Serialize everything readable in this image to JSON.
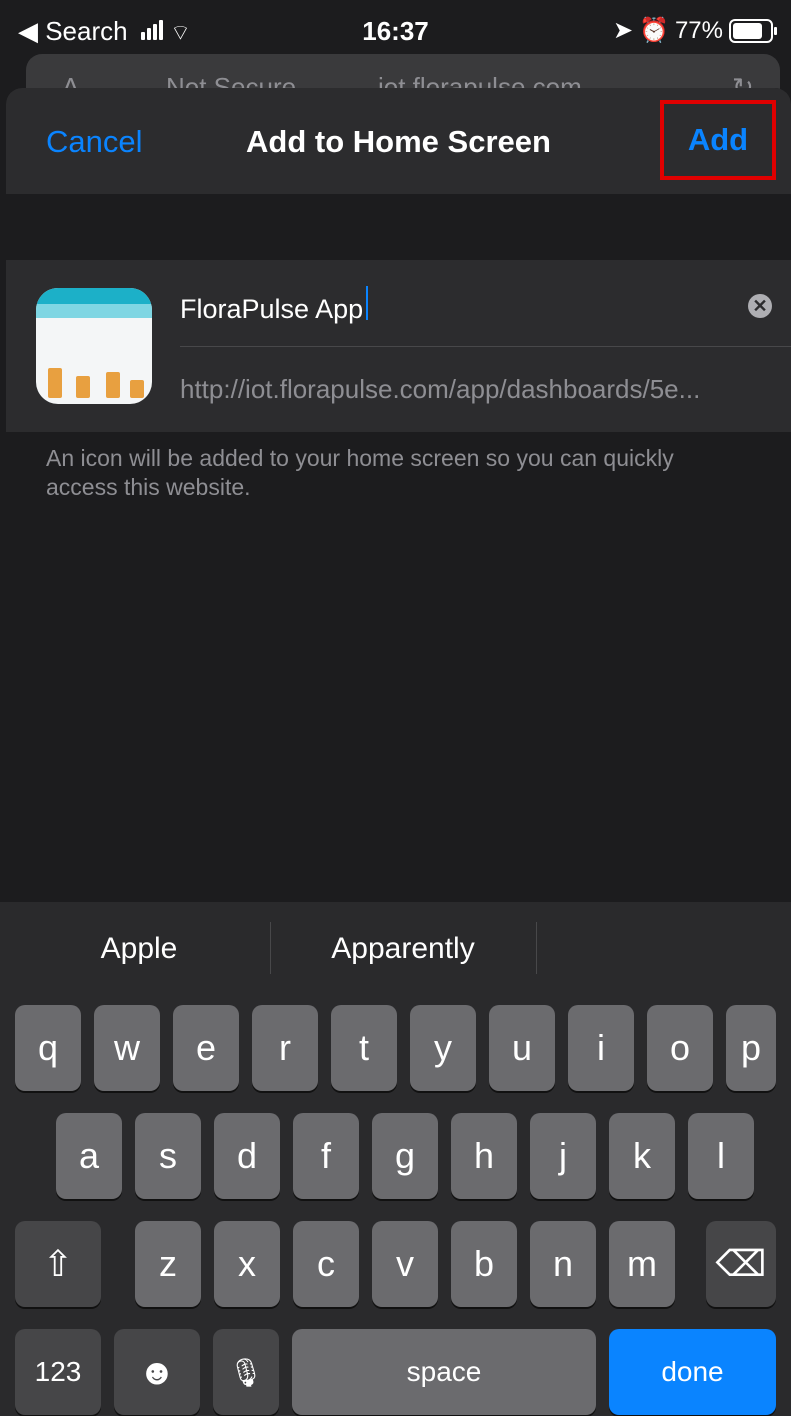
{
  "status_bar": {
    "back_label": "◀ Search",
    "time": "16:37",
    "battery": "77%",
    "icons": [
      "signal-icon",
      "wifi-icon",
      "location-icon",
      "alarm-icon",
      "battery-icon"
    ]
  },
  "url_bar_behind": {
    "left_glyph": "A",
    "security": "Not Secure",
    "domain": "iot.florapulse.com",
    "reload_glyph": "↻"
  },
  "sheet": {
    "cancel_label": "Cancel",
    "title": "Add to Home Screen",
    "add_label": "Add",
    "name_value": "FloraPulse App",
    "url": "http://iot.florapulse.com/app/dashboards/5e...",
    "helper_text": "An icon will be added to your home screen so you can quickly access this website.",
    "clear_glyph": "✕"
  },
  "keyboard": {
    "suggestions": [
      "Apple",
      "Apparently",
      ""
    ],
    "row1": [
      "q",
      "w",
      "e",
      "r",
      "t",
      "y",
      "u",
      "i",
      "o",
      "p"
    ],
    "row2": [
      "a",
      "s",
      "d",
      "f",
      "g",
      "h",
      "j",
      "k",
      "l"
    ],
    "row3": [
      "z",
      "x",
      "c",
      "v",
      "b",
      "n",
      "m"
    ],
    "shift_glyph": "⇧",
    "delete_glyph": "⌫",
    "numbers_label": "123",
    "emoji_glyph": "☻",
    "mic_glyph": "🎙",
    "space_label": "space",
    "done_label": "done"
  },
  "colors": {
    "accent": "#0a84ff",
    "highlight_box": "#e00000",
    "background": "#1c1c1e"
  }
}
